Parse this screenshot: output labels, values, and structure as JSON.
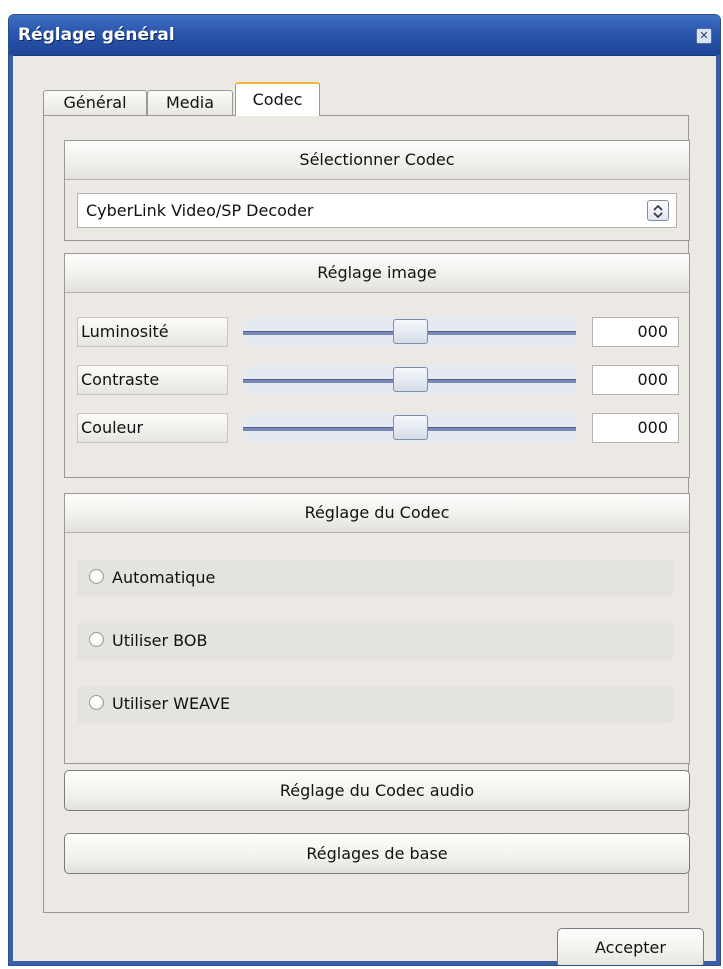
{
  "window": {
    "title": "Réglage général",
    "close_symbol": "✕"
  },
  "tabs": [
    {
      "label": "Général",
      "active": false
    },
    {
      "label": "Media",
      "active": false
    },
    {
      "label": "Codec",
      "active": true
    }
  ],
  "codec_select": {
    "header": "Sélectionner Codec",
    "selected_value": "CyberLink Video/SP Decoder",
    "icon": "spinner-arrows-icon"
  },
  "image_settings": {
    "header": "Réglage image",
    "sliders": [
      {
        "label": "Luminosité",
        "value": "000",
        "position": 0.5
      },
      {
        "label": "Contraste",
        "value": "000",
        "position": 0.5
      },
      {
        "label": "Couleur",
        "value": "000",
        "position": 0.5
      }
    ]
  },
  "codec_settings": {
    "header": "Réglage du Codec",
    "options": [
      {
        "label": "Automatique",
        "selected": false
      },
      {
        "label": "Utiliser BOB",
        "selected": false
      },
      {
        "label": "Utiliser WEAVE",
        "selected": false
      }
    ]
  },
  "buttons": {
    "audio_codec": "Réglage du Codec audio",
    "basic_settings": "Réglages de base",
    "accept": "Accepter"
  },
  "colors": {
    "titlebar": "#2a56ac",
    "active_tab_accent": "#f2b33b",
    "background": "#ece9e4"
  }
}
